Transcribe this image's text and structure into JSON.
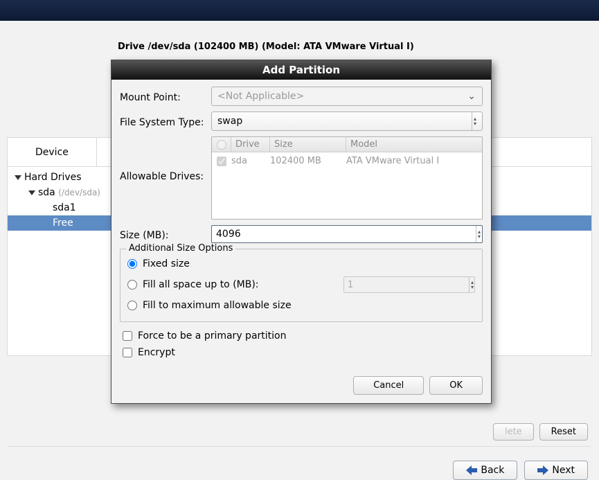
{
  "header": {
    "drive_label": "Drive /dev/sda (102400 MB) (Model: ATA VMware Virtual I)"
  },
  "device_panel": {
    "column_title": "Device",
    "tree": {
      "root": "Hard Drives",
      "drive_name": "sda",
      "drive_path": "(/dev/sda)",
      "partition1": "sda1",
      "free": "Free"
    }
  },
  "dialog": {
    "title": "Add Partition",
    "labels": {
      "mount_point": "Mount Point:",
      "fs_type": "File System Type:",
      "allowable": "Allowable Drives:",
      "size": "Size (MB):",
      "additional": "Additional Size Options",
      "fixed": "Fixed size",
      "fill_up_to": "Fill all space up to (MB):",
      "fill_max": "Fill to maximum allowable size",
      "force_primary": "Force to be a primary partition",
      "encrypt": "Encrypt"
    },
    "values": {
      "mount_point": "<Not Applicable>",
      "fs_type": "swap",
      "size": "4096",
      "fill_up_to_value": "1"
    },
    "drives_table": {
      "cols": {
        "drive": "Drive",
        "size": "Size",
        "model": "Model"
      },
      "row": {
        "drive": "sda",
        "size": "102400 MB",
        "model": "ATA VMware Virtual I"
      }
    },
    "buttons": {
      "cancel": "Cancel",
      "ok": "OK"
    }
  },
  "footer": {
    "delete": "lete",
    "reset": "Reset",
    "back": "Back",
    "next": "Next"
  }
}
